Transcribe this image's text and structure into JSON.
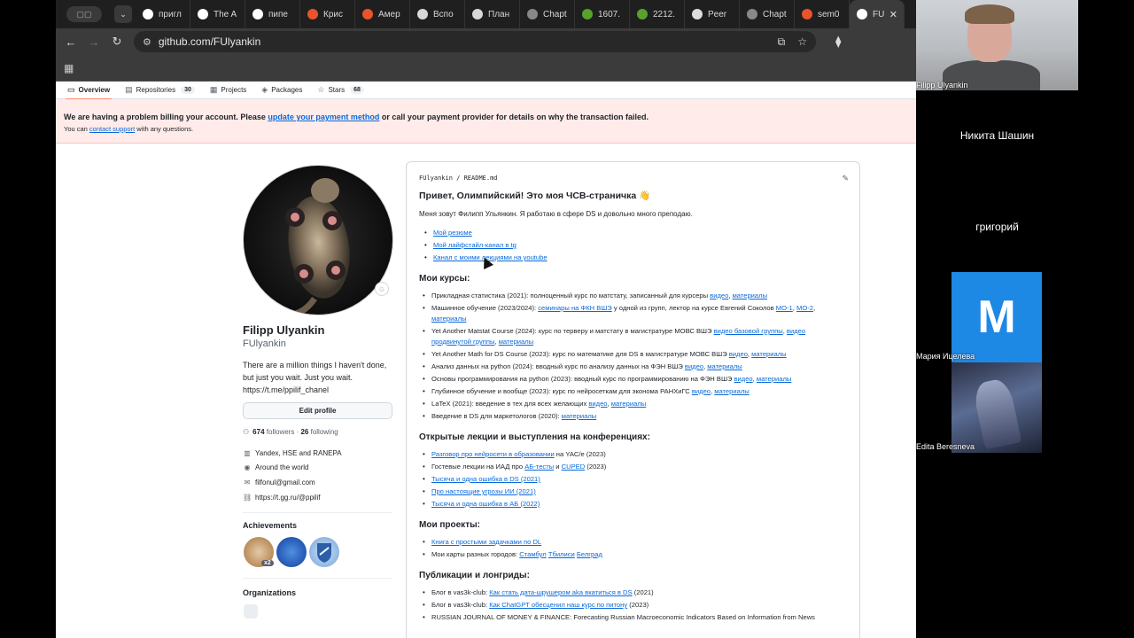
{
  "colors": {
    "accent_link": "#0969da",
    "billing_bg": "#ffebe9",
    "tab_underline": "#fd8c73",
    "zoom_tile": "#1e88e5"
  },
  "browser": {
    "tabs": [
      {
        "icon": "google-icon",
        "color": "#ffffff",
        "label": "пригл"
      },
      {
        "icon": "google-icon",
        "color": "#ffffff",
        "label": "The A"
      },
      {
        "icon": "google-icon",
        "color": "#ffffff",
        "label": "пипе"
      },
      {
        "icon": "k-icon",
        "color": "#e8542c",
        "label": "Крис"
      },
      {
        "icon": "k-icon",
        "color": "#e8542c",
        "label": "Амер"
      },
      {
        "icon": "openai-icon",
        "color": "#d8d8d8",
        "label": "Вспо"
      },
      {
        "icon": "openai-icon",
        "color": "#d8d8d8",
        "label": "План"
      },
      {
        "icon": "chatgpt-icon",
        "color": "#888888",
        "label": "Chapt"
      },
      {
        "icon": "grid-icon",
        "color": "#5aa02c",
        "label": "1607."
      },
      {
        "icon": "grid-icon",
        "color": "#5aa02c",
        "label": "2212."
      },
      {
        "icon": "check-icon",
        "color": "#dddddd",
        "label": "Peer"
      },
      {
        "icon": "chatgpt-icon",
        "color": "#888888",
        "label": "Chapt"
      },
      {
        "icon": "infinity-icon",
        "color": "#e8542c",
        "label": "sem0"
      },
      {
        "icon": "github-icon",
        "color": "#ffffff",
        "label": "FU"
      }
    ],
    "url": "github.com/FUlyankin"
  },
  "repo_nav": [
    {
      "icon": "book-icon",
      "label": "Overview",
      "count": ""
    },
    {
      "icon": "repo-icon",
      "label": "Repositories",
      "count": "30"
    },
    {
      "icon": "table-icon",
      "label": "Projects",
      "count": ""
    },
    {
      "icon": "package-icon",
      "label": "Packages",
      "count": ""
    },
    {
      "icon": "star-icon",
      "label": "Stars",
      "count": "68"
    }
  ],
  "billing": {
    "line1_pre": "We are having a problem billing your account. Please ",
    "line1_link": "update your payment method",
    "line1_post": " or call your payment provider for details on why the transaction failed.",
    "line2_pre": "You can ",
    "line2_link": "contact support",
    "line2_post": " with any questions."
  },
  "profile": {
    "name": "Filipp Ulyankin",
    "login": "FUlyankin",
    "bio": "There are a million things I haven't done, but just you wait. Just you wait. https://t.me/ppilif_chanel",
    "edit_label": "Edit profile",
    "followers": "674",
    "followers_label": "followers",
    "following": "26",
    "following_label": "following",
    "org": "Yandex, HSE and RANEPA",
    "location": "Around the world",
    "email": "filfonul@gmail.com",
    "website": "https://t.gg.ru/@ppilif",
    "achievements_title": "Achievements",
    "achievement_count": "x2",
    "organizations_title": "Organizations"
  },
  "readme": {
    "path_user": "FUlyankin",
    "path_file": "README.md",
    "title": "Привет, Олимпийский! Это моя ЧСВ-страничка 👋",
    "intro": "Меня зовут Филипп Ульянкин. Я работаю в сфере DS и довольно много преподаю.",
    "links": [
      "Мой резюме",
      "Мой лайфстайл-канал в tg",
      "Канал с моими лекциями на youtube"
    ],
    "courses_title": "Мои курсы:",
    "courses": [
      {
        "text": "Прикладная статистика (2021): полноценный курс по матстату, записанный для курсеры ",
        "links": [
          "видео",
          "материалы"
        ]
      },
      {
        "text": "Машинное обучение (2023/2024): ",
        "links": [
          "семинары на ФКН ВШЭ"
        ],
        "mid": " у одной из групп, лектор на курсе Евгений Соколов ",
        "links2": [
          "МО-1",
          "МО-2",
          "материалы"
        ]
      },
      {
        "text": "Yet Another Matstat Course (2024): курс по терверу и матстату в магистратуре МОВС ВШЭ ",
        "links": [
          "видео базовой группы",
          "видео продвинутой группы",
          "материалы"
        ]
      },
      {
        "text": "Yet Another Math for DS Course (2023): курс по математике для DS в магистратуре МОВС ВШЭ ",
        "links": [
          "видео",
          "материалы"
        ]
      },
      {
        "text": "Анализ данных на python (2024): вводный курс по анализу данных на ФЭН ВШЭ ",
        "links": [
          "видео",
          "материалы"
        ]
      },
      {
        "text": "Основы программирования на python (2023): вводный курс по программированию на ФЭН ВШЭ ",
        "links": [
          "видео",
          "материалы"
        ]
      },
      {
        "text": "Глубинное обучение и вообще (2023): курс по нейросеткам для эконома РАНХиГС ",
        "links": [
          "видео",
          "материалы"
        ]
      },
      {
        "text": "LaTeX (2021): введение в тех для всех желающих ",
        "links": [
          "видео",
          "материалы"
        ]
      },
      {
        "text": "Введение в DS для маркетологов (2020): ",
        "links": [
          "материалы"
        ]
      }
    ],
    "talks_title": "Открытые лекции и выступления на конференциях:",
    "talks": [
      {
        "link": "Разговор про нейросети в образовании",
        "text": " на YAC/e (2023)"
      },
      {
        "pre": "Гостевые лекции на ИАД про ",
        "link": "АБ-тесты",
        "mid": " и ",
        "link2": "CUPED",
        "text": " (2023)"
      },
      {
        "link": "Тысяча и одна ошибка в DS (2021)",
        "text": ""
      },
      {
        "link": "Про настоящие угрозы ИИ (2021)",
        "text": ""
      },
      {
        "link": "Тысяча и одна ошибка в АБ (2022)",
        "text": ""
      }
    ],
    "projects_title": "Мои проекты:",
    "projects": [
      {
        "link": "Книга с простыми задачками по DL",
        "pre": ""
      },
      {
        "pre": "Мои карты разных городов: ",
        "links": [
          "Стамбул",
          "Тбилиси",
          "Белград"
        ]
      }
    ],
    "pubs_title": "Публикации и лонгриды:",
    "pubs": [
      {
        "pre": "Блог в vas3k-club: ",
        "link": "Как стать дата-шрушером aka вкатиться в DS",
        "text": " (2021)"
      },
      {
        "pre": "Блог в vas3k-club: ",
        "link": "Как ChatGPT обесценил наш курс по питону",
        "text": " (2023)"
      },
      {
        "pre": "RUSSIAN JOURNAL OF MONEY & FINANCE: Forecasting Russian Macroeconomic Indicators Based on Information from News",
        "link": "",
        "text": ""
      }
    ]
  },
  "video_call": {
    "participants": [
      {
        "name": "Filipp Ulyankin"
      },
      {
        "name": "Никита Шашин"
      },
      {
        "name": "григорий"
      },
      {
        "name": "Мария Ицелева",
        "initial": "M"
      },
      {
        "name": "Edita Beresneva"
      }
    ]
  }
}
